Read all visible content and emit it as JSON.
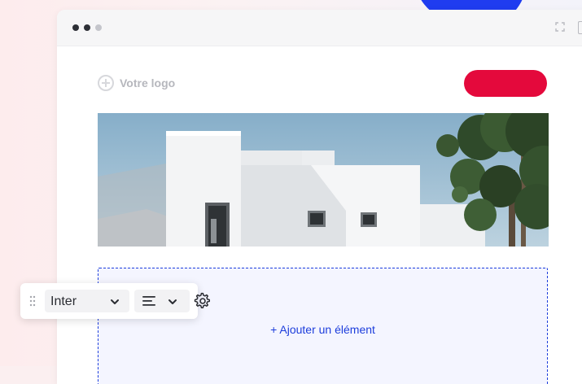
{
  "header": {
    "logo_text": "Votre logo"
  },
  "hero": {
    "image": "white-minimalist-house-with-pine-tree"
  },
  "content": {
    "add_element_label": "+ Ajouter un élément"
  },
  "toolbar": {
    "font_value": "Inter",
    "alignment": "left"
  },
  "colors": {
    "cta": "#e4093c",
    "accent": "#1c3ddc",
    "drop_zone_bg": "#f4f5ff"
  },
  "icons": [
    "plus-circle-icon",
    "expand-icon",
    "drag-handle-icon",
    "chevron-down-icon",
    "align-left-icon",
    "gear-icon"
  ]
}
